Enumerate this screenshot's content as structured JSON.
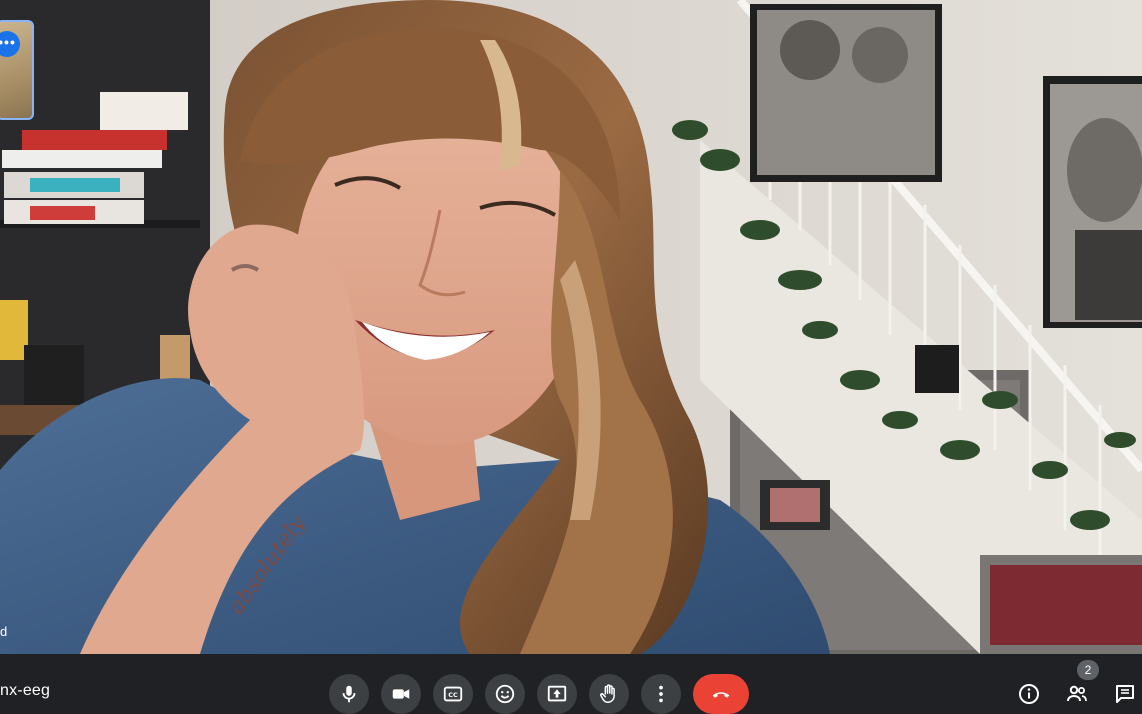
{
  "participant": {
    "name_fragment": "d"
  },
  "meeting": {
    "code_fragment": "nx-eeg"
  },
  "participants_count": "2",
  "controls": [
    {
      "id": "mic",
      "icon": "microphone-icon"
    },
    {
      "id": "camera",
      "icon": "video-camera-icon"
    },
    {
      "id": "captions",
      "icon": "closed-captions-icon"
    },
    {
      "id": "reactions",
      "icon": "emoji-icon"
    },
    {
      "id": "present",
      "icon": "present-screen-icon"
    },
    {
      "id": "raise-hand",
      "icon": "hand-icon"
    },
    {
      "id": "more",
      "icon": "more-vertical-icon"
    },
    {
      "id": "leave",
      "icon": "end-call-icon",
      "color": "#ea4335"
    }
  ],
  "right_controls": [
    {
      "id": "meeting-details",
      "icon": "info-icon"
    },
    {
      "id": "people",
      "icon": "people-icon"
    },
    {
      "id": "chat",
      "icon": "chat-icon"
    }
  ]
}
